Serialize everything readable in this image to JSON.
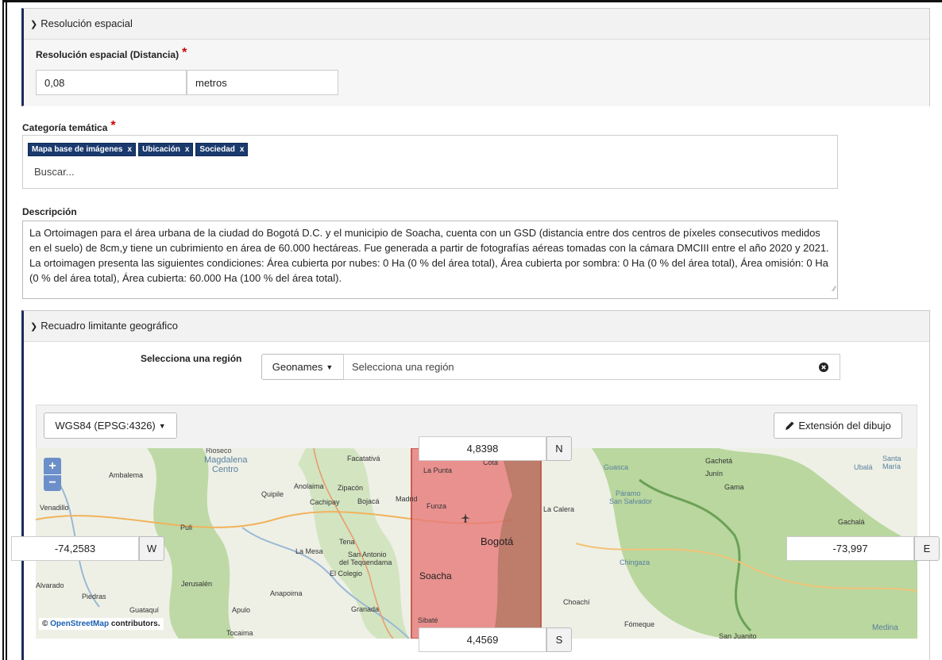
{
  "spatial": {
    "header": "Resolución espacial",
    "field_label": "Resolución espacial (Distancia)",
    "required_mark": "*",
    "value": "0,08",
    "unit": "metros"
  },
  "category": {
    "label": "Categoría temática",
    "required_mark": "*",
    "tags": [
      "Mapa base de imágenes",
      "Ubicación",
      "Sociedad"
    ],
    "tag_remove": "x",
    "search_placeholder": "Buscar..."
  },
  "description": {
    "label": "Descripción",
    "text": "La Ortoimagen para el área urbana de la ciudad do Bogotá D.C. y el municipio de Soacha, cuenta con un GSD (distancia entre dos centros de píxeles consecutivos medidos en el suelo) de 8cm,y tiene un cubrimiento en área de 60.000 hectáreas. Fue generada a partir de fotografías aéreas tomadas con la cámara DMCIII entre el año 2020 y 2021. La ortoimagen presenta las siguientes condiciones: Área cubierta por nubes: 0 Ha (0 % del área total), Área cubierta por sombra: 0 Ha (0 % del área total), Área omisión: 0 Ha (0 % del área total), Área cubierta: 60.000 Ha (100 % del área total)."
  },
  "bbox": {
    "header": "Recuadro limitante geográfico",
    "region_label": "Selecciona una región",
    "region_source": "Geonames",
    "region_placeholder": "Selecciona una región",
    "crs": "WGS84 (EPSG:4326)",
    "draw_button": "Extensión del dibujo",
    "north": "4,8398",
    "north_label": "N",
    "south": "4,4569",
    "south_label": "S",
    "west": "-74,2583",
    "west_label": "W",
    "east": "-73,997",
    "east_label": "E"
  },
  "map": {
    "zoom_in": "+",
    "zoom_out": "−",
    "attribution_prefix": "©",
    "attribution_link": "OpenStreetMap",
    "attribution_suffix": "contributors.",
    "places": [
      "Rioseco",
      "Magdalena",
      "Centro",
      "Ambalema",
      "Venadillo",
      "Facatativá",
      "Anolaima",
      "Zipacón",
      "Quipile",
      "Cachipay",
      "Bojacá",
      "Madrid",
      "Puli",
      "Tena",
      "La Mesa",
      "San Antonio",
      "del Tequendama",
      "El Colegio",
      "Jerusalén",
      "Alvarado",
      "Piedras",
      "Guataquí",
      "Apulo",
      "Anapoima",
      "Granada",
      "Tocaima",
      "La Punta",
      "Cota",
      "Funza",
      "Bogotá",
      "Soacha",
      "Sibaté",
      "La Calera",
      "Guasca",
      "Gachetá",
      "Junín",
      "Ubalá",
      "Gama",
      "Páramo",
      "San Salvador",
      "Gachalá",
      "Santa María",
      "Chingaza",
      "Choachí",
      "Fómeque",
      "Medina",
      "San Juanito"
    ],
    "colors": {
      "bbox_fill": "#e87a7a",
      "bbox_stroke": "#c0392b"
    }
  }
}
